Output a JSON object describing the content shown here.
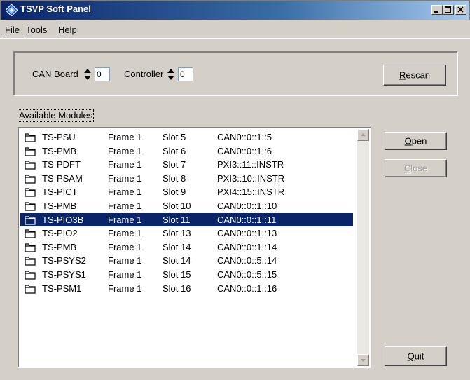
{
  "window": {
    "title": "TSVP Soft Panel"
  },
  "menu": [
    {
      "label": "File",
      "accel": "F",
      "rest": "ile"
    },
    {
      "label": "Tools",
      "accel": "T",
      "rest": "ools"
    },
    {
      "label": "Help",
      "accel": "H",
      "rest": "elp"
    }
  ],
  "controls": {
    "can_board_label": "CAN Board",
    "can_board_value": "0",
    "controller_label": "Controller",
    "controller_value": "0"
  },
  "buttons": {
    "rescan": {
      "label": "Rescan",
      "accel": "R",
      "rest": "escan"
    },
    "open": {
      "label": "Open",
      "accel": "O",
      "rest": "pen"
    },
    "close": {
      "label": "Close",
      "accel": "C",
      "rest": "lose"
    },
    "quit": {
      "label": "Quit",
      "accel": "Q",
      "rest": "uit"
    }
  },
  "available_label": "Available Modules",
  "modules": [
    {
      "name": "TS-PSU",
      "frame": "Frame 1",
      "slot": "Slot 5",
      "address": "CAN0::0::1::5"
    },
    {
      "name": "TS-PMB",
      "frame": "Frame 1",
      "slot": "Slot 6",
      "address": "CAN0::0::1::6"
    },
    {
      "name": "TS-PDFT",
      "frame": "Frame 1",
      "slot": "Slot 7",
      "address": "PXI3::11::INSTR"
    },
    {
      "name": "TS-PSAM",
      "frame": "Frame 1",
      "slot": "Slot 8",
      "address": "PXI3::10::INSTR"
    },
    {
      "name": "TS-PICT",
      "frame": "Frame 1",
      "slot": "Slot 9",
      "address": "PXI4::15::INSTR"
    },
    {
      "name": "TS-PMB",
      "frame": "Frame 1",
      "slot": "Slot 10",
      "address": "CAN0::0::1::10"
    },
    {
      "name": "TS-PIO3B",
      "frame": "Frame 1",
      "slot": "Slot 11",
      "address": "CAN0::0::1::11"
    },
    {
      "name": "TS-PIO2",
      "frame": "Frame 1",
      "slot": "Slot 13",
      "address": "CAN0::0::1::13"
    },
    {
      "name": "TS-PMB",
      "frame": "Frame 1",
      "slot": "Slot 14",
      "address": "CAN0::0::1::14"
    },
    {
      "name": "TS-PSYS2",
      "frame": "Frame 1",
      "slot": "Slot 14",
      "address": "CAN0::0::5::14"
    },
    {
      "name": "TS-PSYS1",
      "frame": "Frame 1",
      "slot": "Slot 15",
      "address": "CAN0::0::5::15"
    },
    {
      "name": "TS-PSM1",
      "frame": "Frame 1",
      "slot": "Slot 16",
      "address": "CAN0::0::1::16"
    }
  ],
  "selected_module_index": 6,
  "colors": {
    "selection": "#0a246a",
    "title_start": "#0a246a",
    "title_end": "#a6caf0"
  }
}
